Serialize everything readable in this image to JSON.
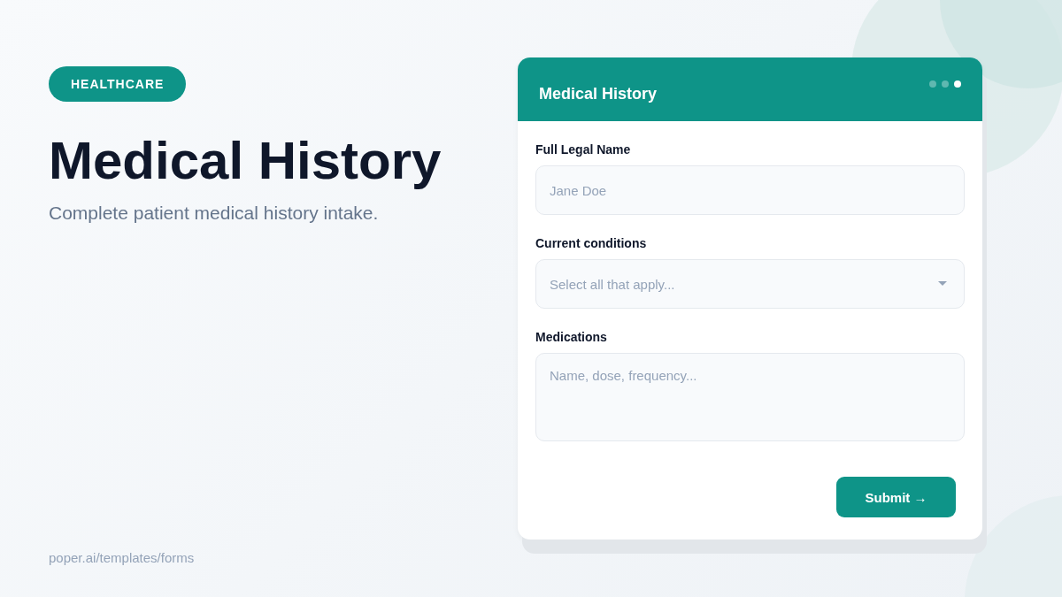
{
  "badge": "HEALTHCARE",
  "title": "Medical History",
  "subtitle": "Complete patient medical history intake.",
  "footer_link": "poper.ai/templates/forms",
  "form": {
    "title": "Medical History",
    "steps": [
      {
        "selected": false
      },
      {
        "selected": false
      },
      {
        "selected": true
      }
    ],
    "fields": [
      {
        "kind": "text",
        "label": "Full Legal Name",
        "placeholder": "Jane Doe"
      },
      {
        "kind": "select",
        "label": "Current conditions",
        "placeholder": "Select all that apply..."
      },
      {
        "kind": "textarea",
        "label": "Medications",
        "placeholder": "Name, dose, frequency..."
      }
    ],
    "submit": "Submit →"
  }
}
